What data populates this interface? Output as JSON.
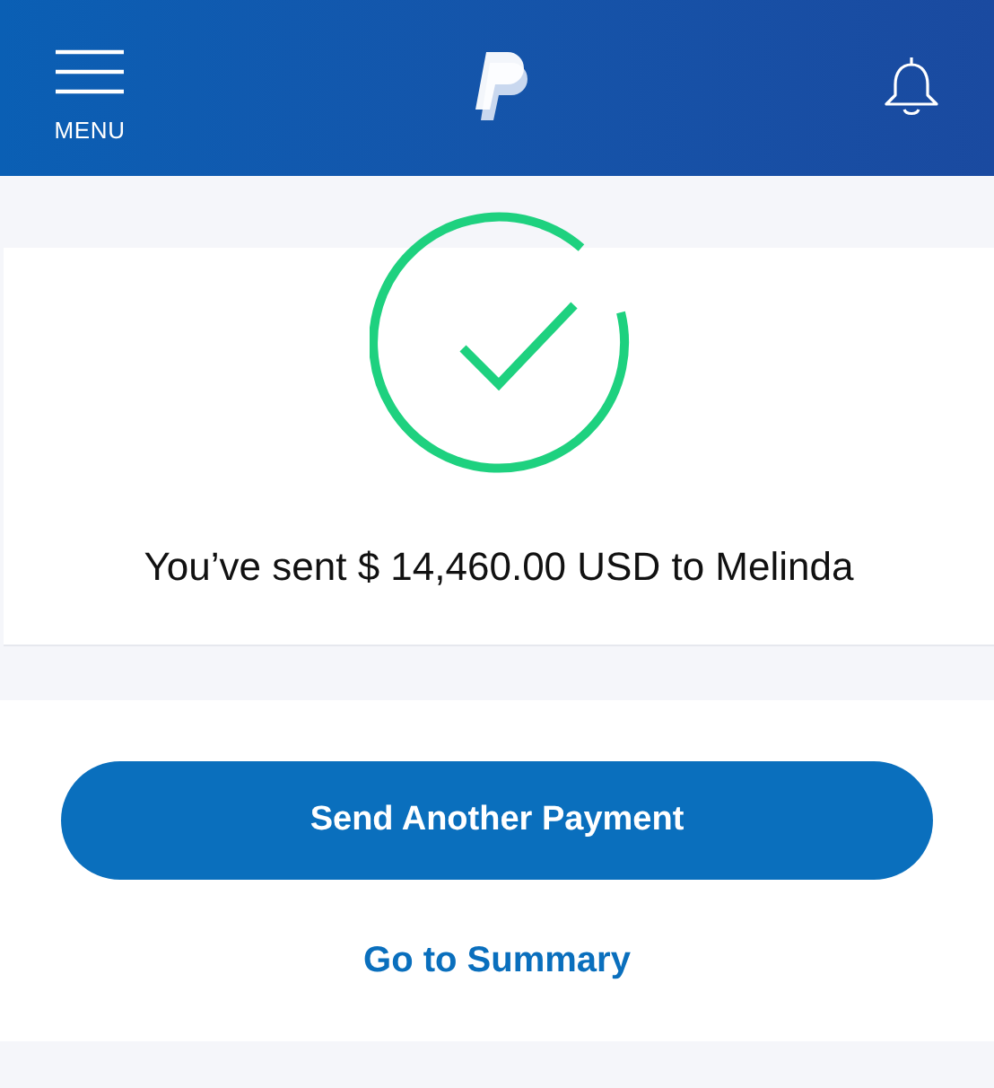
{
  "header": {
    "menu_label": "MENU"
  },
  "confirmation": {
    "message": "You’ve sent $ 14,460.00 USD to Melinda"
  },
  "actions": [
    {
      "kind": "primary",
      "label": "Send Another Payment"
    },
    {
      "kind": "link",
      "label": "Go to Summary"
    }
  ]
}
